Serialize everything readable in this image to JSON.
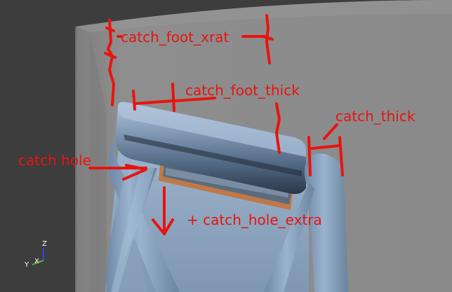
{
  "annotations": {
    "catch_foot_xrat": "catch_foot_xrat",
    "catch_foot_thick": "catch_foot_thick",
    "catch_thick": "catch_thick",
    "catch_hole": "catch hole",
    "catch_hole_extra": "+ catch_hole_extra"
  },
  "axes": {
    "z": "Z",
    "x": "X",
    "y": "Y"
  },
  "colors": {
    "background": "#3b3b3b",
    "wall": "#8c8c8c",
    "part": "#7d96b4",
    "annotation": "#e8140f",
    "hole_rim": "#c07848"
  }
}
